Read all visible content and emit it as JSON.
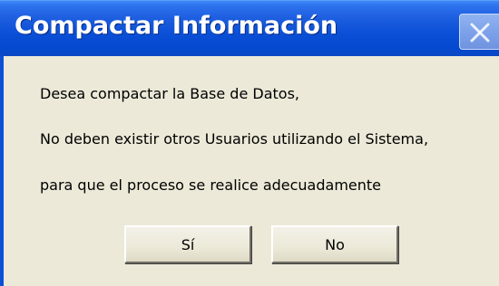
{
  "window": {
    "title": "Compactar Información",
    "close_icon": "close-icon"
  },
  "message": {
    "lines": [
      "Desea compactar la Base de Datos,",
      "No deben existir otros Usuarios utilizando el Sistema,",
      "para que el proceso se realice adecuadamente"
    ]
  },
  "buttons": {
    "yes_label": "Sí",
    "no_label": "No"
  },
  "colors": {
    "titlebar": "#0a4fd6",
    "dialog_bg": "#ece9d8",
    "title_text": "#ffffff"
  }
}
